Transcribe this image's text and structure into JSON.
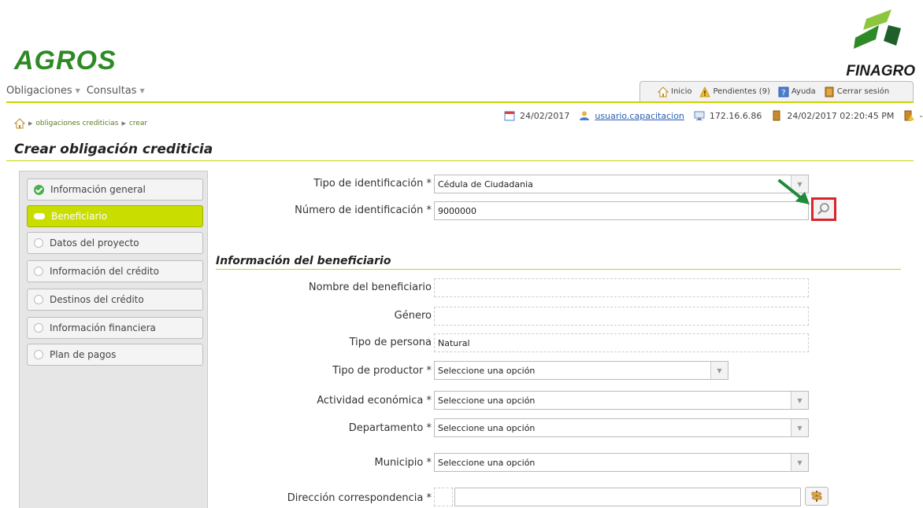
{
  "brand": {
    "app_name": "AGROS",
    "partner_name": "FINAGRO",
    "accent_color": "#c8d400",
    "brand_green": "#2e8a26"
  },
  "menu": {
    "items": [
      {
        "label": "Obligaciones"
      },
      {
        "label": "Consultas"
      }
    ]
  },
  "toolbar": {
    "home_label": "Inicio",
    "pending_label": "Pendientes (9)",
    "help_label": "Ayuda",
    "logout_label": "Cerrar sesión"
  },
  "breadcrumb": {
    "items": [
      "obligaciones crediticias",
      "crear"
    ]
  },
  "status": {
    "date": "24/02/2017",
    "user": "usuario.capacitacion",
    "ip": "172.16.6.86",
    "session": "24/02/2017 02:20:45 PM",
    "extra": "---"
  },
  "page": {
    "title": "Crear obligación crediticia"
  },
  "steps": [
    {
      "label": "Información general",
      "state": "done"
    },
    {
      "label": "Beneficiario",
      "state": "active"
    },
    {
      "label": "Datos del proyecto",
      "state": "pending"
    },
    {
      "label": "Información del crédito",
      "state": "pending"
    },
    {
      "label": "Destinos del crédito",
      "state": "pending"
    },
    {
      "label": "Información financiera",
      "state": "pending"
    },
    {
      "label": "Plan de pagos",
      "state": "pending"
    }
  ],
  "form": {
    "id_type_label": "Tipo de identificación *",
    "id_type_value": "Cédula de Ciudadania",
    "id_number_label": "Número de identificación *",
    "id_number_value": "9000000"
  },
  "beneficiary": {
    "section_title": "Información del beneficiario",
    "name_label": "Nombre del beneficiario",
    "name_value": "",
    "gender_label": "Género",
    "gender_value": "",
    "person_type_label": "Tipo de persona",
    "person_type_value": "Natural",
    "producer_type_label": "Tipo de productor *",
    "producer_type_value": "Seleccione una opción",
    "activity_label": "Actividad económica *",
    "activity_value": "Seleccione una opción",
    "department_label": "Departamento *",
    "department_value": "Seleccione una opción",
    "municipality_label": "Municipio *",
    "municipality_value": "Seleccione una opción",
    "address_label": "Dirección correspondencia *",
    "address_value": ""
  }
}
